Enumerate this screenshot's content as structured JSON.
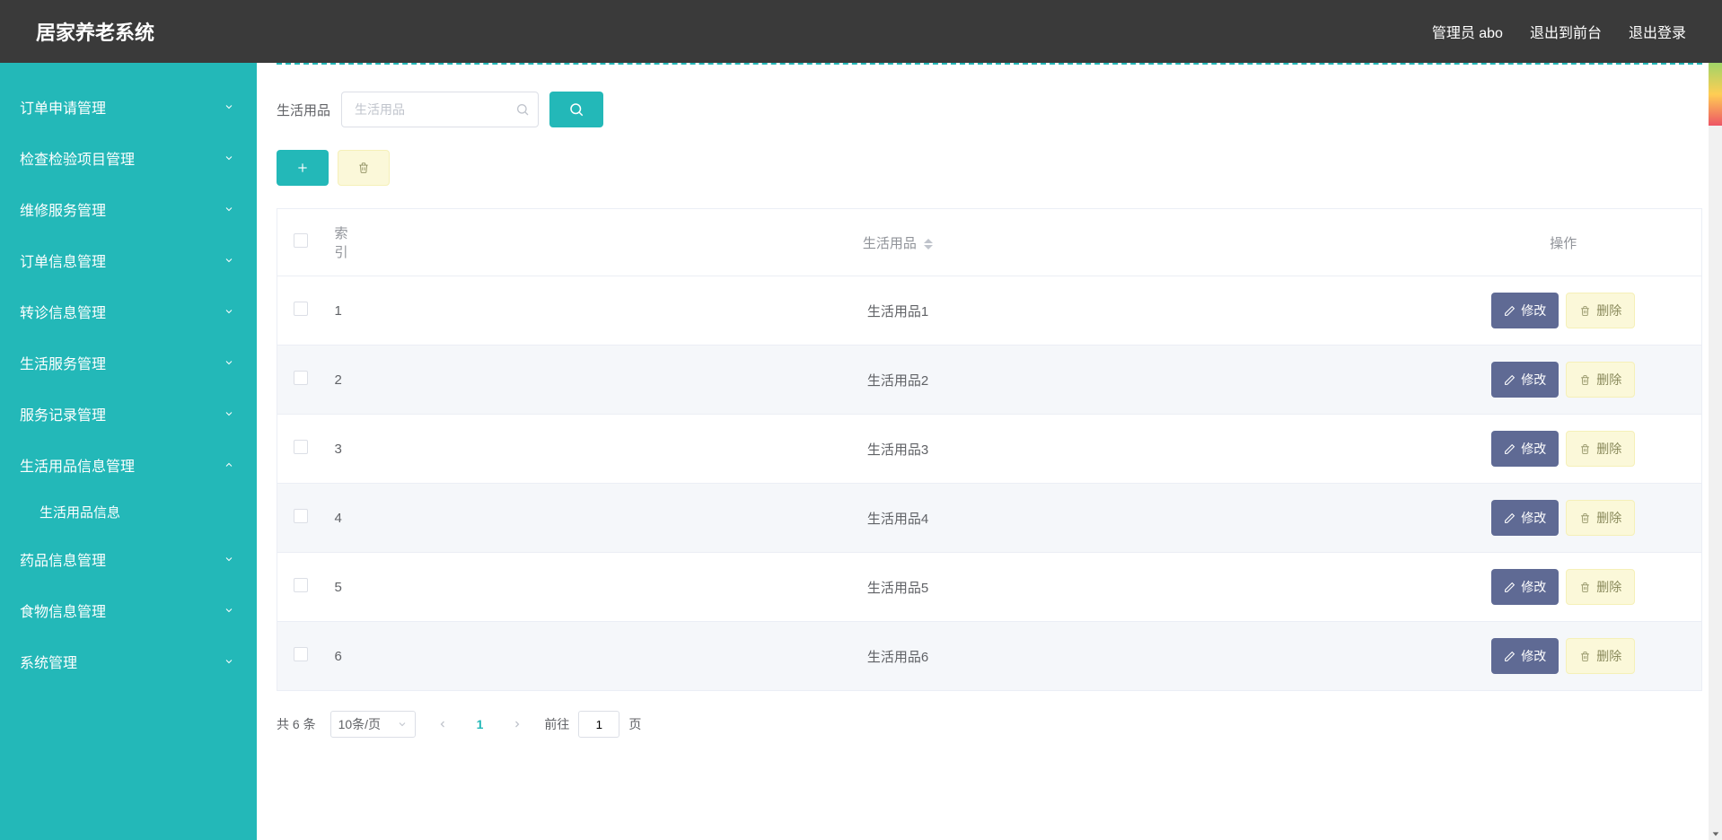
{
  "header": {
    "logo": "居家养老系统",
    "admin": "管理员 abo",
    "exit_front": "退出到前台",
    "logout": "退出登录"
  },
  "sidebar": {
    "items": [
      {
        "label": "订单申请管理",
        "expanded": false
      },
      {
        "label": "检查检验项目管理",
        "expanded": false
      },
      {
        "label": "维修服务管理",
        "expanded": false
      },
      {
        "label": "订单信息管理",
        "expanded": false
      },
      {
        "label": "转诊信息管理",
        "expanded": false
      },
      {
        "label": "生活服务管理",
        "expanded": false
      },
      {
        "label": "服务记录管理",
        "expanded": false
      },
      {
        "label": "生活用品信息管理",
        "expanded": true,
        "children": [
          {
            "label": "生活用品信息"
          }
        ]
      },
      {
        "label": "药品信息管理",
        "expanded": false
      },
      {
        "label": "食物信息管理",
        "expanded": false
      },
      {
        "label": "系统管理",
        "expanded": false
      }
    ]
  },
  "search": {
    "label": "生活用品",
    "placeholder": "生活用品"
  },
  "table": {
    "columns": {
      "index": "索引",
      "name": "生活用品",
      "action": "操作"
    },
    "rows": [
      {
        "idx": "1",
        "name": "生活用品1"
      },
      {
        "idx": "2",
        "name": "生活用品2"
      },
      {
        "idx": "3",
        "name": "生活用品3"
      },
      {
        "idx": "4",
        "name": "生活用品4"
      },
      {
        "idx": "5",
        "name": "生活用品5"
      },
      {
        "idx": "6",
        "name": "生活用品6"
      }
    ],
    "edit_label": "修改",
    "delete_label": "删除"
  },
  "pagination": {
    "total_text": "共 6 条",
    "per_page": "10条/页",
    "current": "1",
    "jump_prefix": "前往",
    "jump_value": "1",
    "jump_suffix": "页"
  }
}
